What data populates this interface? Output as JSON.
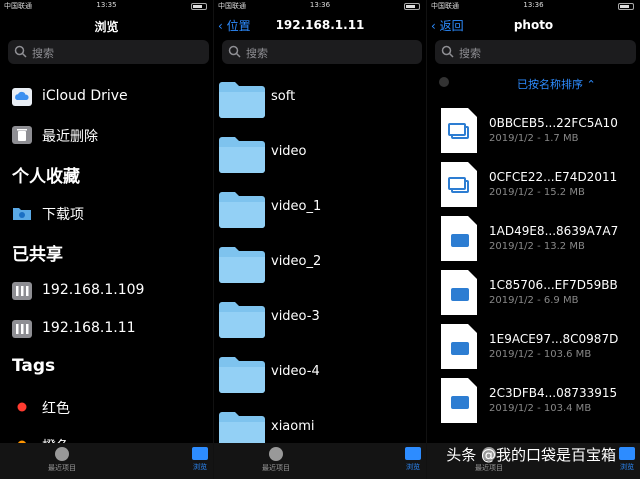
{
  "accent": "#2d8cff",
  "panel1": {
    "status": {
      "carrier": "中国联通",
      "time": "13:35"
    },
    "title": "浏览",
    "search_placeholder": "搜索",
    "items": [
      {
        "label": "iCloud Drive",
        "icon": "icloud-icon"
      },
      {
        "label": "最近删除",
        "icon": "trash-icon"
      }
    ],
    "favorites_header": "个人收藏",
    "favorites": [
      {
        "label": "下载项",
        "icon": "download-folder-icon"
      }
    ],
    "shared_header": "已共享",
    "shared": [
      {
        "label": "192.168.1.109",
        "icon": "server-icon"
      },
      {
        "label": "192.168.1.11",
        "icon": "server-icon"
      }
    ],
    "tags_header": "Tags",
    "tags": [
      {
        "label": "红色",
        "color": "#ff3b30"
      },
      {
        "label": "橙色",
        "color": "#ff9500"
      }
    ],
    "tabbar": {
      "recent": "最近项目",
      "browse": "浏览"
    }
  },
  "panel2": {
    "status": {
      "carrier": "中国联通",
      "time": "13:36"
    },
    "back": "位置",
    "title": "192.168.1.11",
    "search_placeholder": "搜索",
    "folders": [
      "soft",
      "video",
      "video_1",
      "video_2",
      "video-3",
      "video-4",
      "xiaomi"
    ],
    "tabbar": {
      "recent": "最近项目",
      "browse": "浏览"
    }
  },
  "panel3": {
    "status": {
      "carrier": "中国联通",
      "time": "13:36"
    },
    "back": "返回",
    "title": "photo",
    "search_placeholder": "搜索",
    "sort_label": "已按名称排序 ⌃",
    "files": [
      {
        "name": "0BBCEB5...22FC5A10",
        "meta": "2019/1/2 - 1.7 MB",
        "kind": "image"
      },
      {
        "name": "0CFCE22...E74D2011",
        "meta": "2019/1/2 - 15.2 MB",
        "kind": "image"
      },
      {
        "name": "1AD49E8...8639A7A7",
        "meta": "2019/1/2 - 13.2 MB",
        "kind": "video"
      },
      {
        "name": "1C85706...EF7D59BB",
        "meta": "2019/1/2 - 6.9 MB",
        "kind": "video"
      },
      {
        "name": "1E9ACE97...8C0987D",
        "meta": "2019/1/2 - 103.6 MB",
        "kind": "video"
      },
      {
        "name": "2C3DFB4...08733915",
        "meta": "2019/1/2 - 103.4 MB",
        "kind": "video"
      }
    ],
    "tabbar": {
      "recent": "最近项目",
      "browse": "浏览"
    }
  },
  "watermark": "头条 @我的口袋是百宝箱"
}
